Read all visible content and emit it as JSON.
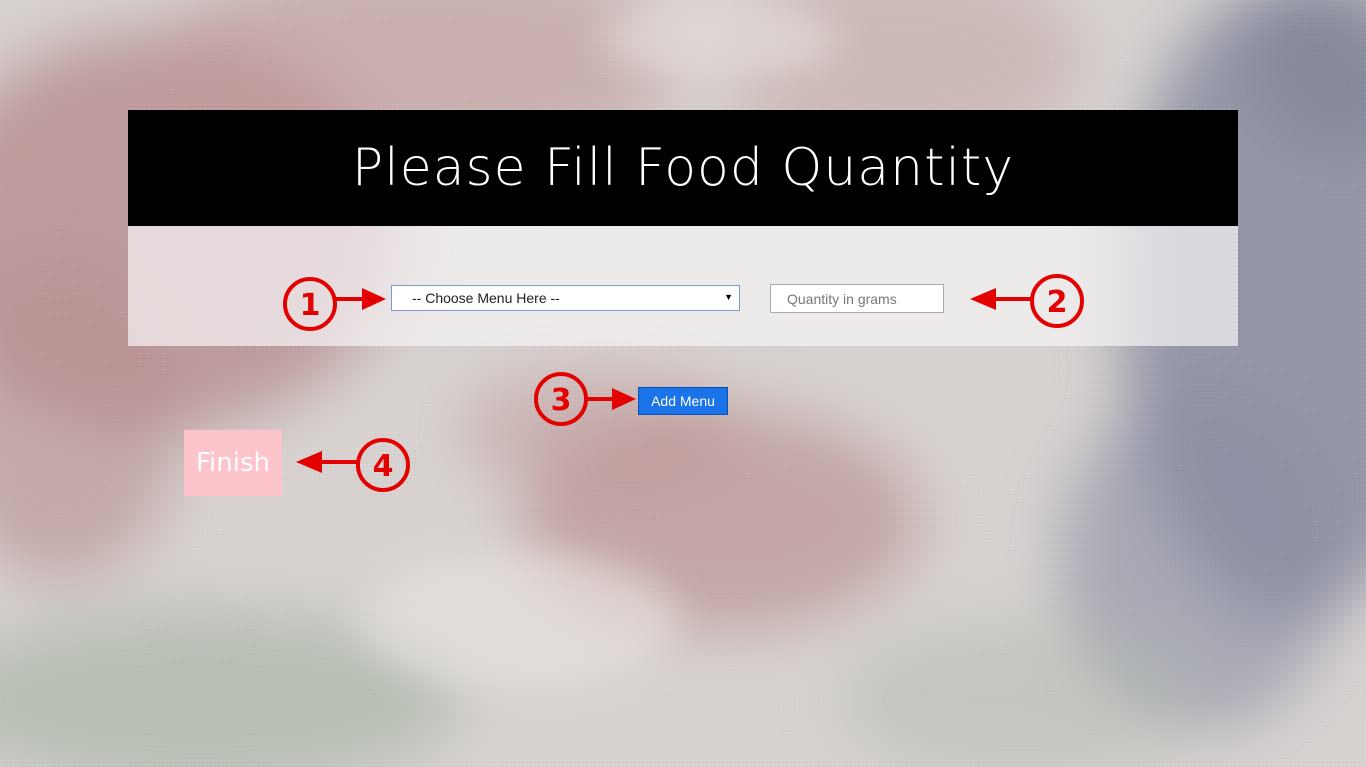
{
  "header": {
    "title": "Please Fill Food Quantity"
  },
  "form": {
    "menu_select": {
      "selected": "-- Choose Menu Here --"
    },
    "quantity_input": {
      "value": "",
      "placeholder": "Quantity in grams"
    }
  },
  "buttons": {
    "add_menu": "Add Menu",
    "finish": "Finish"
  },
  "annotations": [
    {
      "label": "1"
    },
    {
      "label": "2"
    },
    {
      "label": "3"
    },
    {
      "label": "4"
    }
  ],
  "colors": {
    "header_bg": "#000000",
    "add_button": "#1a73e8",
    "finish_button": "#fdc4cc",
    "annotation": "#e30000"
  },
  "icons": {
    "select_caret": "caret-down-icon"
  }
}
